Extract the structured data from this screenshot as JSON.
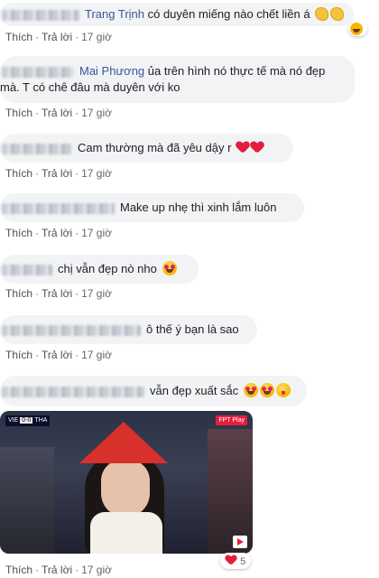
{
  "actions": {
    "like": "Thích",
    "reply": "Trả lời",
    "sep": "·",
    "time": "17 giờ"
  },
  "comments": [
    {
      "name": "Trang Trịnh",
      "text": " có duyên miếng nào chết liền á"
    },
    {
      "name": "Mai Phương",
      "text": " ủa trên hình nó thực tế mà nó đẹp mà. T có chê đâu mà duyên với ko"
    },
    {
      "text": "Cam thường mà đã yêu dậy r"
    },
    {
      "text": "Make up nhẹ thì xinh lắm luôn"
    },
    {
      "text": "chị vẫn đẹp nò nho"
    },
    {
      "text": "ô thế ý bạn là sao"
    },
    {
      "text": "vẫn đẹp xuất sắc"
    }
  ],
  "reaction_badge_count": "5",
  "photo": {
    "score_left": "VIE",
    "score_value": "0-0",
    "score_right": "THA",
    "broadcast": "FPT Play"
  },
  "icons": [
    "clapping-emoji",
    "laughing-emoji",
    "heart-emoji",
    "heart-eyes-emoji",
    "kiss-emoji",
    "heart-reaction-icon",
    "play-icon"
  ],
  "colors": {
    "bubble": "#f2f3f5",
    "name": "#385898",
    "meta": "#606770",
    "heart": "#e41e3f"
  }
}
